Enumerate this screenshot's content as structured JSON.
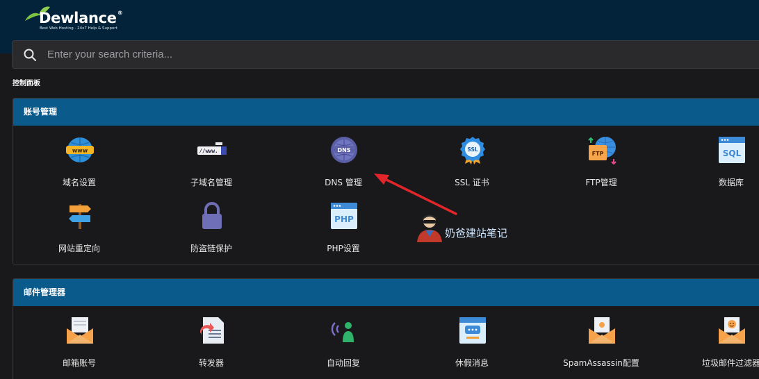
{
  "brand": {
    "name": "Dewlance",
    "reg": "®",
    "tagline": "Best Web Hosting - 24x7 Help & Support"
  },
  "search": {
    "placeholder": "Enter your search criteria..."
  },
  "breadcrumb": "控制面板",
  "sections": [
    {
      "title": "账号管理",
      "items": [
        {
          "label": "域名设置",
          "icon": "www-globe-icon"
        },
        {
          "label": "子域名管理",
          "icon": "subdomain-icon"
        },
        {
          "label": "DNS 管理",
          "icon": "dns-globe-icon",
          "icon_text": "DNS"
        },
        {
          "label": "SSL 证书",
          "icon": "ssl-badge-icon",
          "icon_text": "SSL"
        },
        {
          "label": "FTP管理",
          "icon": "ftp-icon",
          "icon_text": "FTP"
        },
        {
          "label": "数据库",
          "icon": "sql-database-icon",
          "icon_text": "SQL"
        },
        {
          "label": "网站重定向",
          "icon": "signpost-icon"
        },
        {
          "label": "防盗链保护",
          "icon": "padlock-icon"
        },
        {
          "label": "PHP设置",
          "icon": "php-window-icon",
          "icon_text": "PHP"
        }
      ]
    },
    {
      "title": "邮件管理器",
      "items": [
        {
          "label": "邮箱账号",
          "icon": "mail-account-icon"
        },
        {
          "label": "转发器",
          "icon": "forwarder-icon"
        },
        {
          "label": "自动回复",
          "icon": "autoreply-icon"
        },
        {
          "label": "休假消息",
          "icon": "vacation-message-icon"
        },
        {
          "label": "SpamAssassin配置",
          "icon": "spam-envelope-icon"
        },
        {
          "label": "垃圾邮件过滤器",
          "icon": "spam-filter-icon"
        }
      ]
    }
  ],
  "watermark": {
    "text": "奶爸建站笔记"
  },
  "colors": {
    "topbar": "#022339",
    "panel_header": "#0a5a8c",
    "background": "#19191b",
    "annotation_arrow": "#e0262b"
  }
}
